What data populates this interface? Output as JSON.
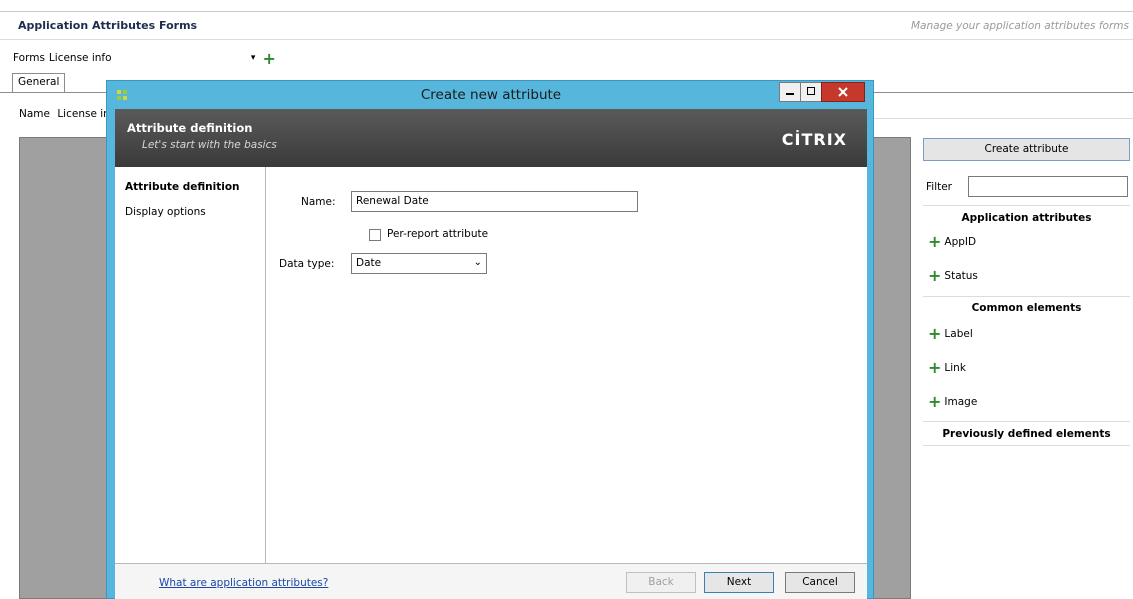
{
  "app": {
    "title": "Application Attributes Forms",
    "subtitle": "Manage your application attributes forms"
  },
  "forms": {
    "label": "Forms",
    "selected": "License info"
  },
  "tabs": [
    {
      "label": "General"
    }
  ],
  "name_row": {
    "label": "Name",
    "value": "License info"
  },
  "right_panel": {
    "create_button": "Create attribute",
    "filter_label": "Filter",
    "filter_value": "",
    "sections": [
      {
        "title": "Application attributes",
        "items": [
          "AppID",
          "Status"
        ]
      },
      {
        "title": "Common elements",
        "items": [
          "Label",
          "Link",
          "Image"
        ]
      },
      {
        "title": "Previously defined elements",
        "items": []
      }
    ]
  },
  "dialog": {
    "title": "Create new attribute",
    "banner": {
      "title": "Attribute definition",
      "subtitle": "Let's start with the basics",
      "logo": "CİTRIX"
    },
    "nav": [
      "Attribute definition",
      "Display options"
    ],
    "fields": {
      "name_label": "Name:",
      "name_value": "Renewal Date",
      "per_report_label": "Per-report attribute",
      "per_report_checked": false,
      "data_type_label": "Data type:",
      "data_type_value": "Date"
    },
    "footer": {
      "help_link": "What are application attributes?",
      "back": "Back",
      "next": "Next",
      "cancel": "Cancel"
    }
  },
  "colors": {
    "dialog_frame": "#56b6dc",
    "banner": "#4a4a4a",
    "plus_green": "#2d8a2d",
    "close_red": "#c7382c",
    "link": "#1a47a8"
  }
}
